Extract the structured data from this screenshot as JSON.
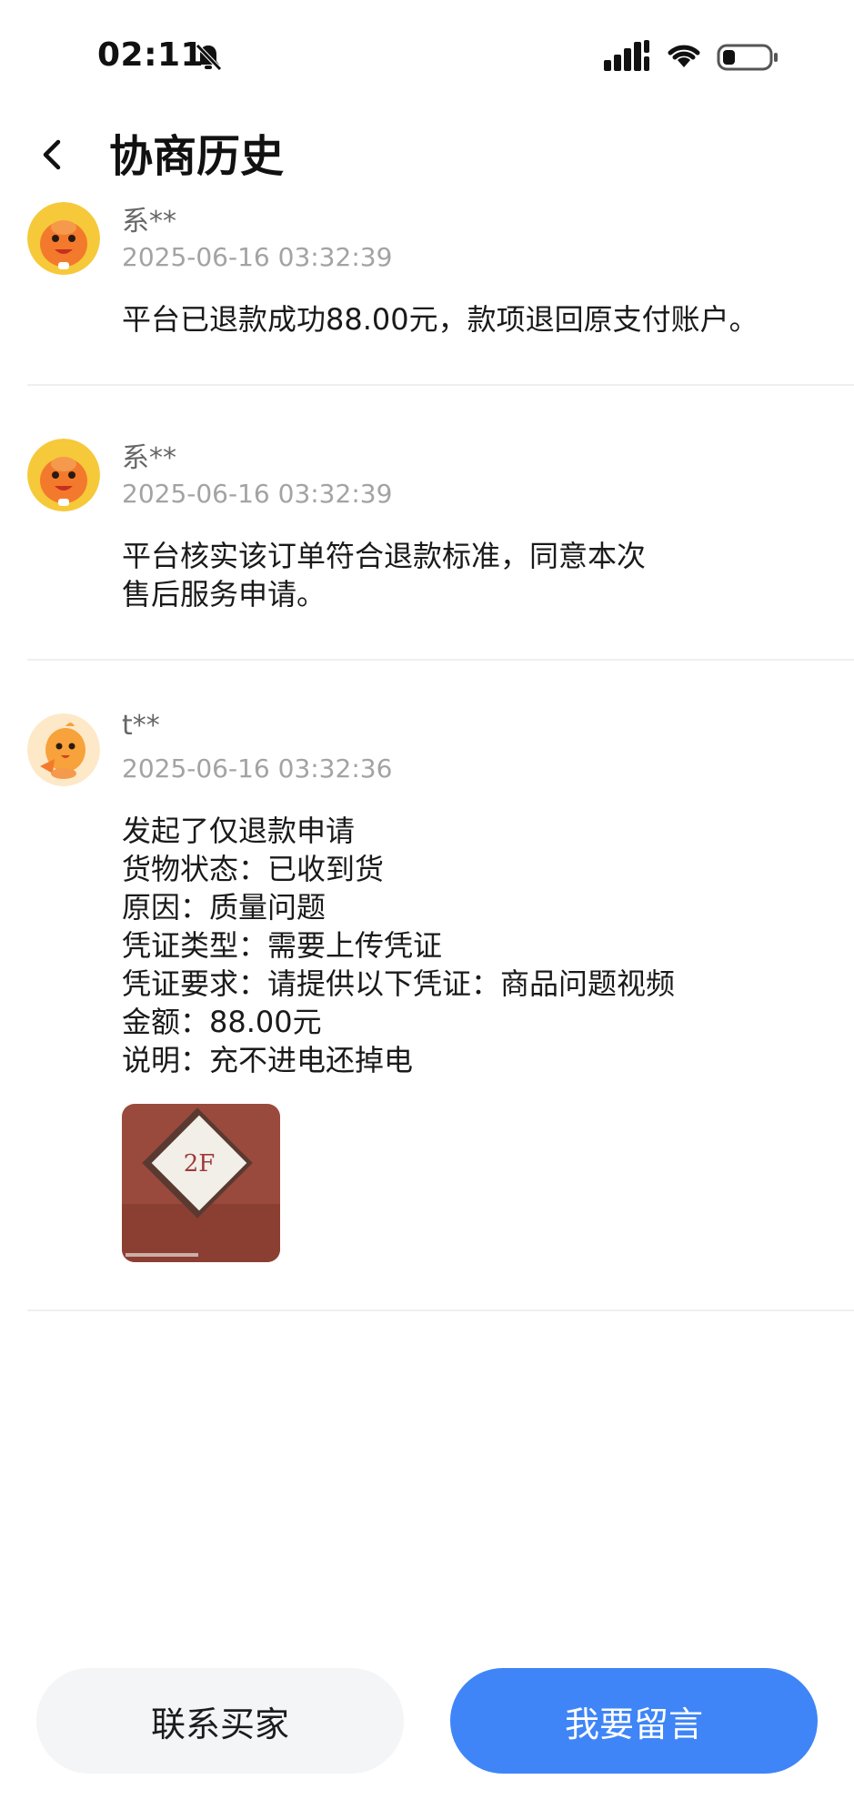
{
  "status_bar": {
    "time": "02:11",
    "icons": [
      "bell-mute-icon",
      "signal-icon",
      "wifi-icon",
      "battery-icon"
    ],
    "battery_level": 0.25
  },
  "header": {
    "back_icon": "chevron-left-icon",
    "title": "协商历史"
  },
  "entries": [
    {
      "name": "系**",
      "time": "2025-06-16 03:32:39",
      "lines": [
        "平台已退款成功88.00元，款项退回原支付账户。"
      ]
    },
    {
      "name": "系**",
      "time": "2025-06-16 03:32:39",
      "lines": [
        "平台核实该订单符合退款标准，同意本次",
        "售后服务申请。"
      ]
    },
    {
      "name": "t**",
      "time": "2025-06-16 03:32:36",
      "lines": [
        "发起了仅退款申请",
        "货物状态：已收到货",
        "原因：质量问题",
        "凭证类型：需要上传凭证",
        "凭证要求：请提供以下凭证：商品问题视频",
        "金额：88.00元",
        "说明：充不进电还掉电"
      ],
      "evidence_sign_text": "2F"
    }
  ],
  "actions": {
    "contact_buyer": "联系买家",
    "leave_message": "我要留言"
  },
  "colors": {
    "primary": "#3f85f7",
    "secondary_button_bg": "#f4f5f7",
    "time_text": "#a3a3a3",
    "divider": "#efefef"
  }
}
